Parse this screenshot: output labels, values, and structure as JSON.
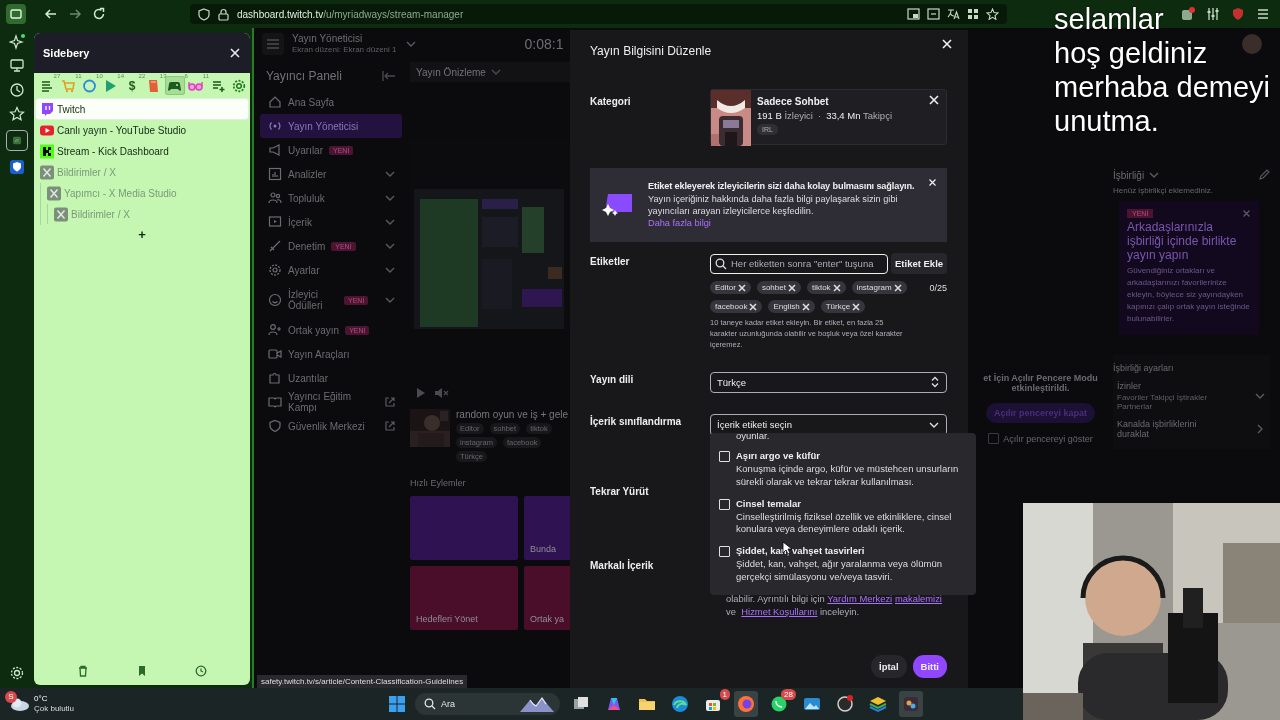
{
  "browser": {
    "url_host": "dashboard.twitch.tv",
    "url_path": "/u/myriadways/stream-manager"
  },
  "sidebery": {
    "title": "Sidebery",
    "panels": [
      {
        "kind": "list",
        "count": "27",
        "selected": false
      },
      {
        "kind": "cart",
        "count": "11",
        "selected": false
      },
      {
        "kind": "ring",
        "count": "10",
        "selected": false
      },
      {
        "kind": "play",
        "count": "14",
        "selected": false
      },
      {
        "kind": "glyph",
        "glyph": "$",
        "count": "22",
        "selected": false
      },
      {
        "kind": "book",
        "count": "13",
        "selected": false
      },
      {
        "kind": "gamepad",
        "count": "6",
        "selected": true
      },
      {
        "kind": "glasses",
        "count": "11",
        "selected": false
      }
    ],
    "tabs": [
      {
        "title": "Twitch",
        "kind": "twitch",
        "selected": true,
        "discarded": false
      },
      {
        "title": "Canlı yayın - YouTube Studio",
        "kind": "youtube",
        "selected": false,
        "discarded": false
      },
      {
        "title": "Stream - Kick Dashboard",
        "kind": "kick",
        "selected": false,
        "discarded": false
      },
      {
        "title": "Bildirimler / X",
        "kind": "x",
        "selected": false,
        "discarded": true,
        "children": [
          {
            "title": "Yapımcı - X Media Studio",
            "kind": "x",
            "selected": false,
            "discarded": true,
            "children": [
              {
                "title": "Bildirimler / X",
                "kind": "x",
                "selected": false,
                "discarded": true
              }
            ]
          }
        ]
      }
    ],
    "new_tab": "+"
  },
  "page": {
    "header": {
      "title": "Yayın Yöneticisi",
      "subtitle": "Ekran düzeni: Ekran düzeni 1",
      "timer": "0:08:1"
    },
    "nav": {
      "title": "Yayıncı Paneli",
      "items": [
        {
          "label": "Ana Sayfa",
          "kind": "home",
          "selected": false,
          "expandable": false,
          "external": false
        },
        {
          "label": "Yayın Yöneticisi",
          "kind": "broadcast",
          "selected": true,
          "expandable": false,
          "external": false
        },
        {
          "label": "Uyarılar",
          "kind": "megaphone",
          "badge": "YENİ",
          "selected": false,
          "expandable": false,
          "external": false
        },
        {
          "label": "Analizler",
          "kind": "chart",
          "selected": false,
          "expandable": true,
          "external": false
        },
        {
          "label": "Topluluk",
          "kind": "people",
          "selected": false,
          "expandable": true,
          "external": false
        },
        {
          "label": "İçerik",
          "kind": "content",
          "selected": false,
          "expandable": true,
          "external": false
        },
        {
          "label": "Denetim",
          "kind": "sword",
          "badge": "YENİ",
          "selected": false,
          "expandable": true,
          "external": false
        },
        {
          "label": "Ayarlar",
          "kind": "gear",
          "selected": false,
          "expandable": true,
          "external": false
        },
        {
          "label": "İzleyici Ödülleri",
          "kind": "smile",
          "badge": "YENİ",
          "selected": false,
          "expandable": true,
          "external": false
        },
        {
          "label": "Ortak yayın",
          "kind": "person-add",
          "badge": "YENİ",
          "selected": false,
          "expandable": false,
          "external": false
        },
        {
          "label": "Yayın Araçları",
          "kind": "camera",
          "selected": false,
          "expandable": false,
          "external": false
        },
        {
          "label": "Uzantılar",
          "kind": "puzzle",
          "selected": false,
          "expandable": false,
          "external": false
        },
        {
          "label": "Yayıncı Eğitim Kampı",
          "kind": "book",
          "selected": false,
          "expandable": false,
          "external": true
        },
        {
          "label": "Güvenlik Merkezi",
          "kind": "shield",
          "selected": false,
          "expandable": false,
          "external": true
        }
      ]
    },
    "preview": {
      "title": "Yayın Önizleme",
      "stream_title": "random oyun ve iş + gele",
      "tags": [
        "Editor",
        "sohbet",
        "tiktok",
        "instagram",
        "facebook",
        "Türkçe"
      ]
    },
    "quick_actions": {
      "title": "Hızlı Eylemler",
      "tiles": [
        {
          "color": "#2e1251"
        },
        {
          "label": "Bunda",
          "color": "#2e1251"
        },
        {
          "label": "Hedefleri Yönet",
          "color": "#4a0d2a"
        },
        {
          "label": "Ortak ya",
          "color": "#4a0d2a"
        }
      ]
    },
    "popout": {
      "message": "et İçin Açılır Pencere Modu etkinleştirildi.",
      "button": "Açılır pencereyi kapat",
      "checkbox": {
        "label": "Açılır pencereyi göster",
        "checked": false
      }
    },
    "collab": {
      "title": "İşbirliği",
      "empty": "Henüz işbirlikçi eklemediniz.",
      "card": {
        "badge": "YENİ",
        "title": "Arkadaşlarınızla işbirliği içinde birlikte yayın yapın",
        "body": "Güvendiğiniz ortakları ve arkadaşlarınızı favorilerinize ekleyin, böylece siz yayındayken kapınızı çalıp ortak yayın isteğinde bulunabilirler."
      },
      "settings": {
        "title": "İşbirliği ayarları",
        "permissions": "İzinler",
        "permissions_value": "Favoriler Takipçi İştirakler Partnerlar",
        "pause": "Kanalda işbirliklerini duraklat"
      }
    }
  },
  "modal": {
    "title": "Yayın Bilgisini Düzenle",
    "category": {
      "label": "Kategori",
      "name": "Sadece Sohbet",
      "viewers": "191 B",
      "viewers_label": "İzleyici",
      "separator": "·",
      "followers": "33,4 Mn",
      "followers_label": "Takipçi",
      "tag": "IRL"
    },
    "promo": {
      "title": "Etiket ekleyerek izleyicilerin sizi daha kolay bulmasını sağlayın.",
      "body": "Yayın içeriğiniz hakkında daha fazla bilgi paylaşarak sizin gibi yayıncıları arayan izleyicilerce keşfedilin.",
      "link": "Daha fazla bilgi"
    },
    "tags": {
      "label": "Etiketler",
      "placeholder": "Her etiketten sonra \"enter\" tuşuna",
      "button": "Etiket Ekle",
      "items": [
        "Editor",
        "sohbet",
        "tiktok",
        "instagram",
        "facebook",
        "English",
        "Türkçe"
      ],
      "count": "0/25",
      "help": "10 taneye kadar etiket ekleyin. Bir etiket, en fazla 25 karakter uzunluğunda olabilir ve boşluk veya özel karakter içeremez."
    },
    "language": {
      "label": "Yayın dili",
      "value": "Türkçe"
    },
    "classification": {
      "label": "İçerik sınıflandırma",
      "placeholder": "İçerik etiketi seçin",
      "dropdown": {
        "cut_text": "oyunlar.",
        "options": [
          {
            "title": "Aşırı argo ve küfür",
            "description": "Konuşma içinde argo, küfür ve müstehcen unsurların sürekli olarak ve tekrar tekrar kullanılması.",
            "checked": false
          },
          {
            "title": "Cinsel temalar",
            "description": "Cinselleştirilmiş fiziksel özellik ve etkinliklere, cinsel konulara veya deneyimlere odaklı içerik.",
            "checked": false
          },
          {
            "title": "Şiddet, kan, vahşet tasvirleri",
            "description": "Şiddet, kan, vahşet, ağır yaralanma veya ölümün gerçekçi simülasyonu ve/veya tasviri.",
            "checked": false
          }
        ]
      }
    },
    "rerun": {
      "label": "Tekrar Yürüt"
    },
    "branded": {
      "label": "Markalı İçerik",
      "note": [
        {
          "text": "olabilir. Ayrıntılı bilgi için "
        },
        {
          "text": "Yardım Merkezi",
          "kind": "link"
        },
        {
          "text": "makalemizi",
          "kind": "link"
        },
        {
          "text": " ve "
        },
        {
          "text": "Hizmet Koşullarını",
          "kind": "link"
        },
        {
          "text": " inceleyin."
        }
      ]
    },
    "buttons": [
      {
        "label": "İptal",
        "kind": "secondary"
      },
      {
        "label": "Bitti",
        "kind": "primary"
      }
    ]
  },
  "link_preview": "safety.twitch.tv/s/article/Content-Classification-Guidelines",
  "caption": [
    "selamlar",
    "hoş geldiniz",
    "merhaba demeyi",
    "unutma."
  ],
  "taskbar": {
    "weather": {
      "badge": "S",
      "temperature": "0°C",
      "condition": "Çok bulutlu"
    },
    "search": {
      "placeholder": "Ara"
    },
    "apps": [
      {
        "kind": "task-view",
        "active": false
      },
      {
        "kind": "copilot",
        "active": false
      },
      {
        "kind": "folder",
        "active": false
      },
      {
        "kind": "edge",
        "active": false
      },
      {
        "kind": "store",
        "badge": "1",
        "active": false
      },
      {
        "kind": "firefox",
        "active": true
      },
      {
        "kind": "whatsapp",
        "badge": "28",
        "active": false
      },
      {
        "kind": "photos",
        "active": false
      },
      {
        "kind": "obs",
        "active": false
      },
      {
        "kind": "stack",
        "active": false
      },
      {
        "kind": "editor",
        "active": true
      }
    ]
  }
}
